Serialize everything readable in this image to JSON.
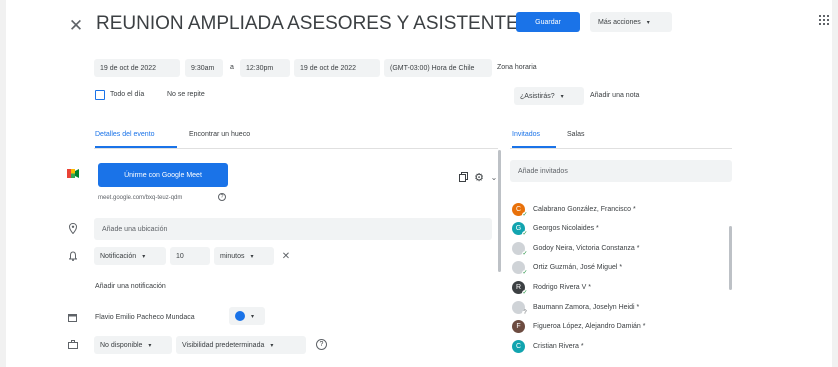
{
  "header": {
    "close_icon": "close-icon",
    "title": "REUNION AMPLIADA ASESORES Y ASISTENTES S",
    "save_label": "Guardar",
    "more_actions_label": "Más acciones",
    "apps_icon": "apps-grid-icon"
  },
  "datetime": {
    "start_date": "19 de oct de 2022",
    "start_time": "9:30am",
    "separator": "a",
    "end_time": "12:30pm",
    "end_date": "19 de oct de 2022",
    "timezone": "(GMT-03:00) Hora de Chile",
    "timezone_link": "Zona horaria",
    "all_day_label": "Todo el día",
    "repeat_label": "No se repite"
  },
  "rsvp": {
    "attend_label": "¿Asistirás?",
    "add_note_label": "Añadir una nota"
  },
  "tabs": {
    "details": "Detalles del evento",
    "find_time": "Encontrar un hueco"
  },
  "meet": {
    "join_label": "Únirme con Google Meet",
    "link": "meet.google.com/bxq-teuz-qdm"
  },
  "location": {
    "placeholder": "Añade una ubicación"
  },
  "notification": {
    "type": "Notificación",
    "value": "10",
    "unit": "minutos",
    "add_label": "Añadir una notificación"
  },
  "organizer": {
    "name": "Flavio Emilio Pacheco Mundaca",
    "color": "#1a73e8"
  },
  "availability": {
    "status": "No disponible",
    "visibility": "Visibilidad predeterminada"
  },
  "guests_panel": {
    "tab_guests": "Invitados",
    "tab_rooms": "Salas",
    "add_placeholder": "Añade invitados",
    "guests": [
      {
        "name": "Calabrano González, Francisco *",
        "initial": "C",
        "color": "#e8710a",
        "status": "accepted"
      },
      {
        "name": "Georgos Nicolaides *",
        "initial": "G",
        "color": "#12a4af",
        "status": "accepted"
      },
      {
        "name": "Godoy Neira, Victoria Constanza *",
        "initial": "",
        "color": "#cfd3d7",
        "status": "accepted"
      },
      {
        "name": "Ortiz Guzmán, José Miguel *",
        "initial": "",
        "color": "#cfd3d7",
        "status": "accepted"
      },
      {
        "name": "Rodrigo Rivera V *",
        "initial": "R",
        "color": "#3c4043",
        "status": "accepted"
      },
      {
        "name": "Baumann Zamora, Joselyn Heidi *",
        "initial": "",
        "color": "#cfd3d7",
        "status": "pending"
      },
      {
        "name": "Figueroa López, Alejandro Damián *",
        "initial": "F",
        "color": "#6d4c41",
        "status": ""
      },
      {
        "name": "Cristian Rivera *",
        "initial": "C",
        "color": "#12a4af",
        "status": ""
      }
    ]
  }
}
